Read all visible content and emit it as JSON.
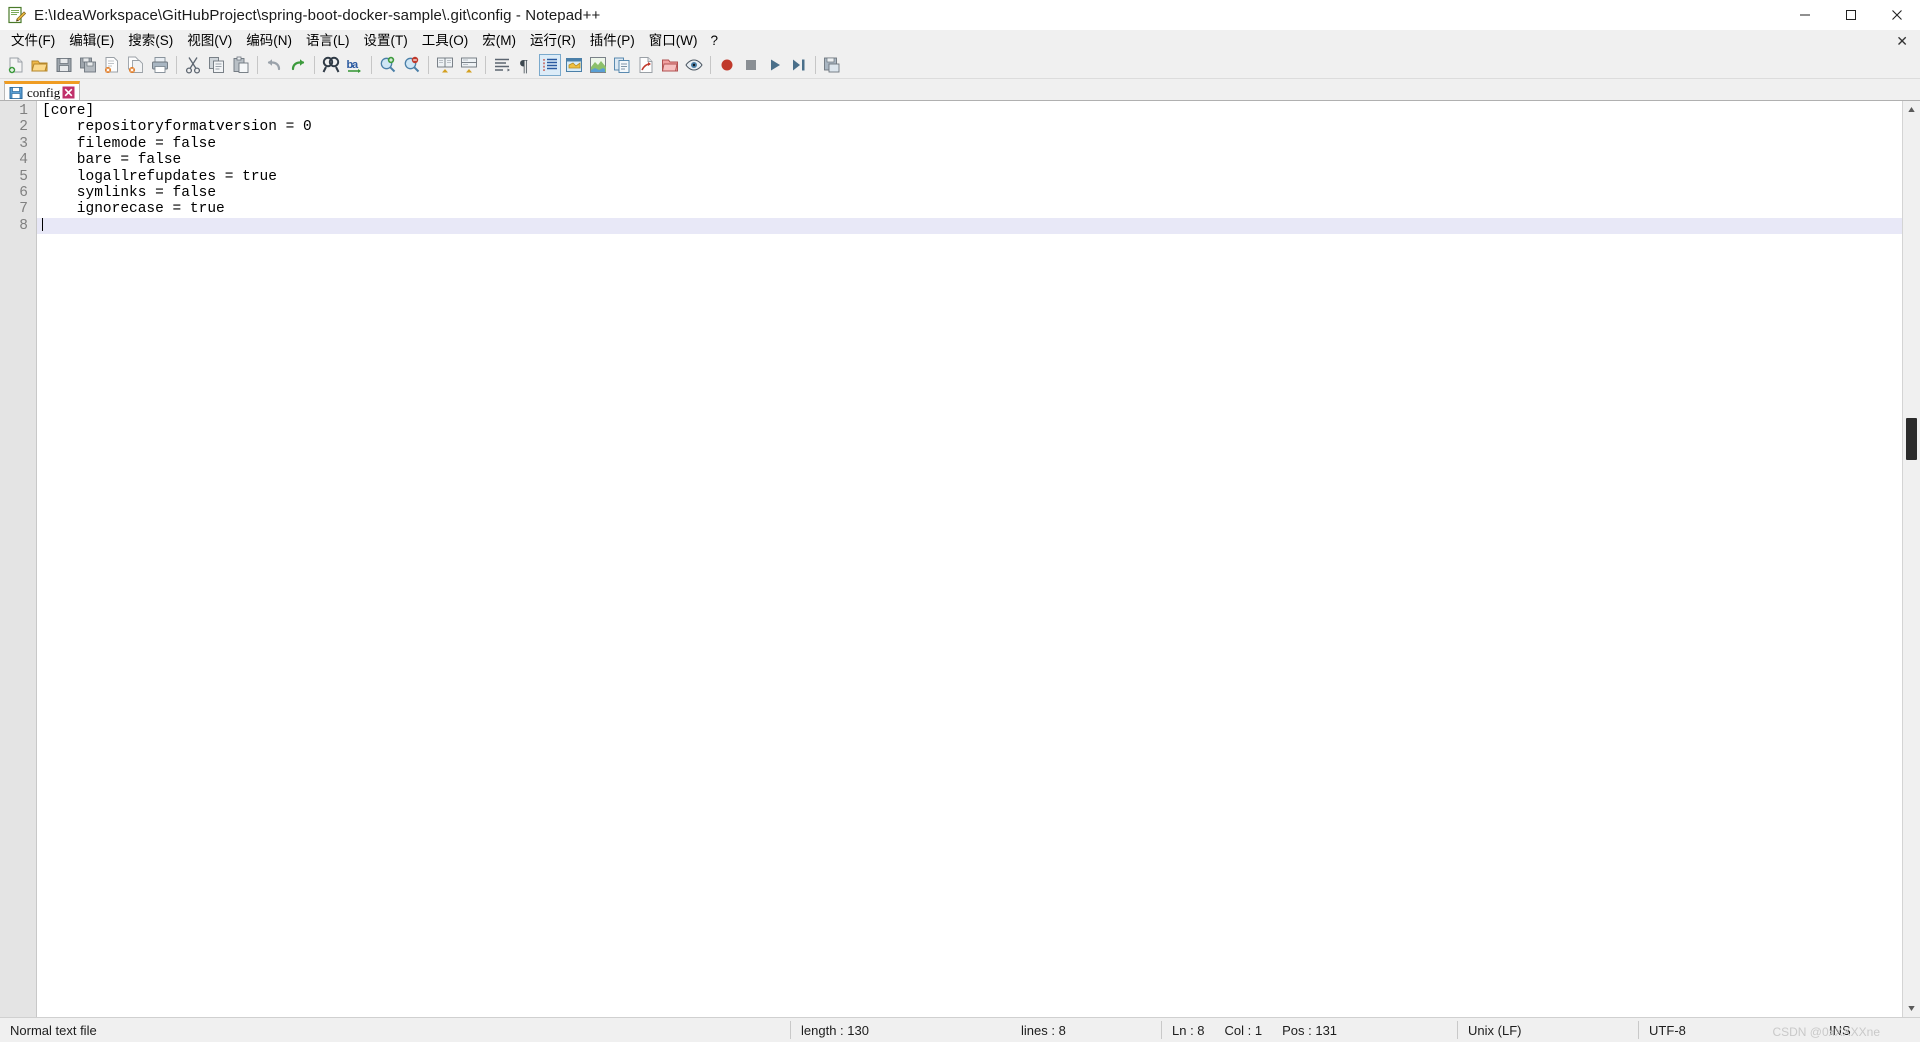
{
  "window": {
    "title": "E:\\IdeaWorkspace\\GitHubProject\\spring-boot-docker-sample\\.git\\config - Notepad++",
    "app_icon": "notepad-plus-plus-icon",
    "minimize_label": "─",
    "maximize_label": "□",
    "close_label": "✕"
  },
  "menubar": {
    "items": [
      {
        "label": "文件(F)",
        "name": "menu-file"
      },
      {
        "label": "编辑(E)",
        "name": "menu-edit"
      },
      {
        "label": "搜索(S)",
        "name": "menu-search"
      },
      {
        "label": "视图(V)",
        "name": "menu-view"
      },
      {
        "label": "编码(N)",
        "name": "menu-encoding"
      },
      {
        "label": "语言(L)",
        "name": "menu-language"
      },
      {
        "label": "设置(T)",
        "name": "menu-settings"
      },
      {
        "label": "工具(O)",
        "name": "menu-tools"
      },
      {
        "label": "宏(M)",
        "name": "menu-macro"
      },
      {
        "label": "运行(R)",
        "name": "menu-run"
      },
      {
        "label": "插件(P)",
        "name": "menu-plugins"
      },
      {
        "label": "窗口(W)",
        "name": "menu-window"
      },
      {
        "label": "?",
        "name": "menu-help"
      }
    ],
    "close_doc_label": "✕"
  },
  "toolbar": {
    "buttons": [
      {
        "name": "new-file-icon",
        "title": "新建"
      },
      {
        "name": "open-file-icon",
        "title": "打开"
      },
      {
        "name": "save-icon",
        "title": "保存"
      },
      {
        "name": "save-all-icon",
        "title": "全部保存"
      },
      {
        "name": "close-file-icon",
        "title": "关闭"
      },
      {
        "name": "close-all-files-icon",
        "title": "全部关闭"
      },
      {
        "name": "print-icon",
        "title": "打印"
      },
      {
        "name": "separator-1",
        "title": ""
      },
      {
        "name": "cut-icon",
        "title": "剪切"
      },
      {
        "name": "copy-icon",
        "title": "复制"
      },
      {
        "name": "paste-icon",
        "title": "粘贴"
      },
      {
        "name": "separator-2",
        "title": ""
      },
      {
        "name": "undo-icon",
        "title": "撤销"
      },
      {
        "name": "redo-icon",
        "title": "重做"
      },
      {
        "name": "separator-3",
        "title": ""
      },
      {
        "name": "find-icon",
        "title": "查找"
      },
      {
        "name": "replace-icon",
        "title": "替换"
      },
      {
        "name": "separator-4",
        "title": ""
      },
      {
        "name": "zoom-in-icon",
        "title": "放大"
      },
      {
        "name": "zoom-out-icon",
        "title": "缩小"
      },
      {
        "name": "separator-5",
        "title": ""
      },
      {
        "name": "sync-vertical-scroll-icon",
        "title": "同步垂直滚动"
      },
      {
        "name": "sync-horizontal-scroll-icon",
        "title": "同步水平滚动"
      },
      {
        "name": "separator-6",
        "title": ""
      },
      {
        "name": "word-wrap-icon",
        "title": "自动换行"
      },
      {
        "name": "show-all-characters-icon",
        "title": "显示所有字符"
      },
      {
        "name": "indent-guide-icon",
        "title": "显示缩进参考线"
      },
      {
        "name": "user-defined-dialog-icon",
        "title": "用户自定义语言"
      },
      {
        "name": "document-map-icon",
        "title": "文档地图"
      },
      {
        "name": "function-list-icon",
        "title": "函数列表"
      },
      {
        "name": "document-switcher-icon",
        "title": "文档列表"
      },
      {
        "name": "folder-as-workspace-icon",
        "title": "文件夹作为工作区"
      },
      {
        "name": "monitoring-icon",
        "title": "监视文件"
      },
      {
        "name": "separator-7",
        "title": ""
      },
      {
        "name": "record-macro-icon",
        "title": "开始录制宏"
      },
      {
        "name": "stop-recording-icon",
        "title": "停止录制宏"
      },
      {
        "name": "play-macro-icon",
        "title": "播放宏"
      },
      {
        "name": "run-macro-multiple-icon",
        "title": "多次运行宏"
      },
      {
        "name": "separator-8",
        "title": ""
      },
      {
        "name": "save-macro-icon",
        "title": "保存当前录制的宏"
      }
    ]
  },
  "tabs": [
    {
      "label": "config",
      "icon": "saved-file-icon",
      "close": "✕",
      "active": true
    }
  ],
  "editor": {
    "lines": [
      {
        "number": "1",
        "text": "[core]"
      },
      {
        "number": "2",
        "text": "    repositoryformatversion = 0"
      },
      {
        "number": "3",
        "text": "    filemode = false"
      },
      {
        "number": "4",
        "text": "    bare = false"
      },
      {
        "number": "5",
        "text": "    logallrefupdates = true"
      },
      {
        "number": "6",
        "text": "    symlinks = false"
      },
      {
        "number": "7",
        "text": "    ignorecase = true"
      },
      {
        "number": "8",
        "text": ""
      }
    ],
    "current_line": 8,
    "colors": {
      "gutter_background": "#e4e4e4",
      "gutter_text": "#808080",
      "current_line_highlight": "#e8e8f7",
      "text": "#000000",
      "background": "#ffffff",
      "tab_accent": "#ef9c22"
    }
  },
  "statusbar": {
    "doc_type": "Normal text file",
    "length_label": "length : 130",
    "lines_label": "lines : 8",
    "ln_label": "Ln : 8",
    "col_label": "Col : 1",
    "pos_label": "Pos : 131",
    "eol": "Unix (LF)",
    "encoding": "UTF-8",
    "insert_mode": "INS",
    "watermark": "CSDN @0xXXXXne"
  }
}
